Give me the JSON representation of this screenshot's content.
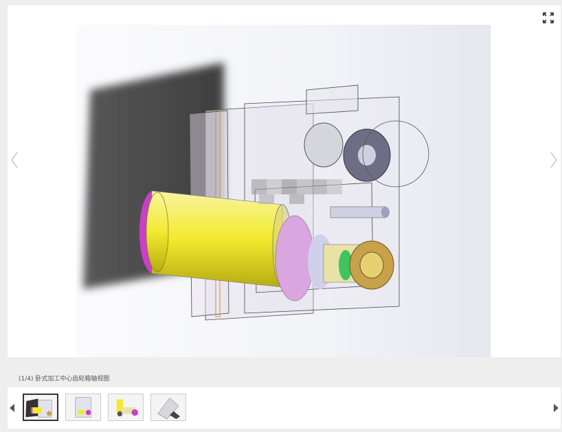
{
  "viewer": {
    "caption": "(1/4) 卧式加工中心齿轮箱轴视图",
    "fullscreen_icon": "fullscreen-icon",
    "prev_icon": "chevron-left-icon",
    "next_icon": "chevron-right-icon"
  },
  "thumbnails": [
    {
      "name": "thumbnail-1",
      "active": true
    },
    {
      "name": "thumbnail-2",
      "active": false
    },
    {
      "name": "thumbnail-3",
      "active": false
    },
    {
      "name": "thumbnail-4",
      "active": false
    }
  ],
  "colors": {
    "accent_yellow": "#f2ea2e",
    "accent_magenta": "#d23bd2",
    "accent_green": "#39c25a",
    "shadow": "#3a3a3a"
  }
}
